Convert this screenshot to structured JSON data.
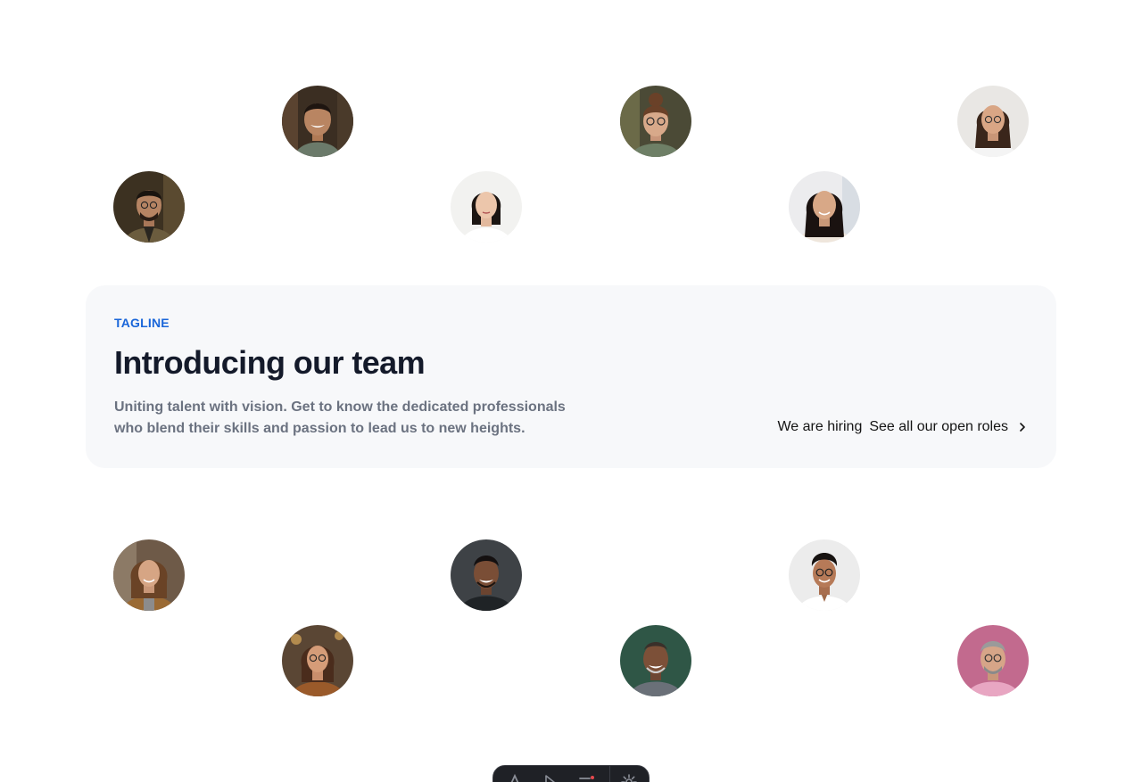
{
  "team_top": [
    {
      "name": "team-member-1",
      "icon": "avatar-man-beard"
    },
    {
      "name": "team-member-2",
      "icon": "avatar-woman-glasses-bun"
    },
    {
      "name": "team-member-3",
      "icon": "avatar-woman-glasses"
    },
    {
      "name": "team-member-4",
      "icon": "avatar-man-glasses-jacket"
    },
    {
      "name": "team-member-5",
      "icon": "avatar-woman-white-shirt"
    },
    {
      "name": "team-member-6",
      "icon": "avatar-woman-long-hair"
    }
  ],
  "team_bottom": [
    {
      "name": "team-member-7",
      "icon": "avatar-woman-curly-hair"
    },
    {
      "name": "team-member-8",
      "icon": "avatar-man-dark-shirt"
    },
    {
      "name": "team-member-9",
      "icon": "avatar-man-glasses-white-shirt"
    },
    {
      "name": "team-member-10",
      "icon": "avatar-woman-brown-jacket"
    },
    {
      "name": "team-member-11",
      "icon": "avatar-man-green-bg"
    },
    {
      "name": "team-member-12",
      "icon": "avatar-man-pink-shirt"
    }
  ],
  "intro": {
    "tagline": "TAGLINE",
    "title": "Introducing our team",
    "description": "Uniting talent with vision. Get to know the dedicated professionals who blend their skills and passion to lead us to new heights.",
    "hiring_prefix": "We are hiring",
    "hiring_link": "See all our open roles"
  },
  "colors": {
    "accent": "#1a66d9",
    "heading": "#141a2a",
    "body_text": "#6b7280",
    "card_bg": "#f7f8fa"
  },
  "dock": {
    "icons": [
      "text-icon",
      "pointer-icon",
      "menu-icon",
      "settings-icon"
    ]
  }
}
